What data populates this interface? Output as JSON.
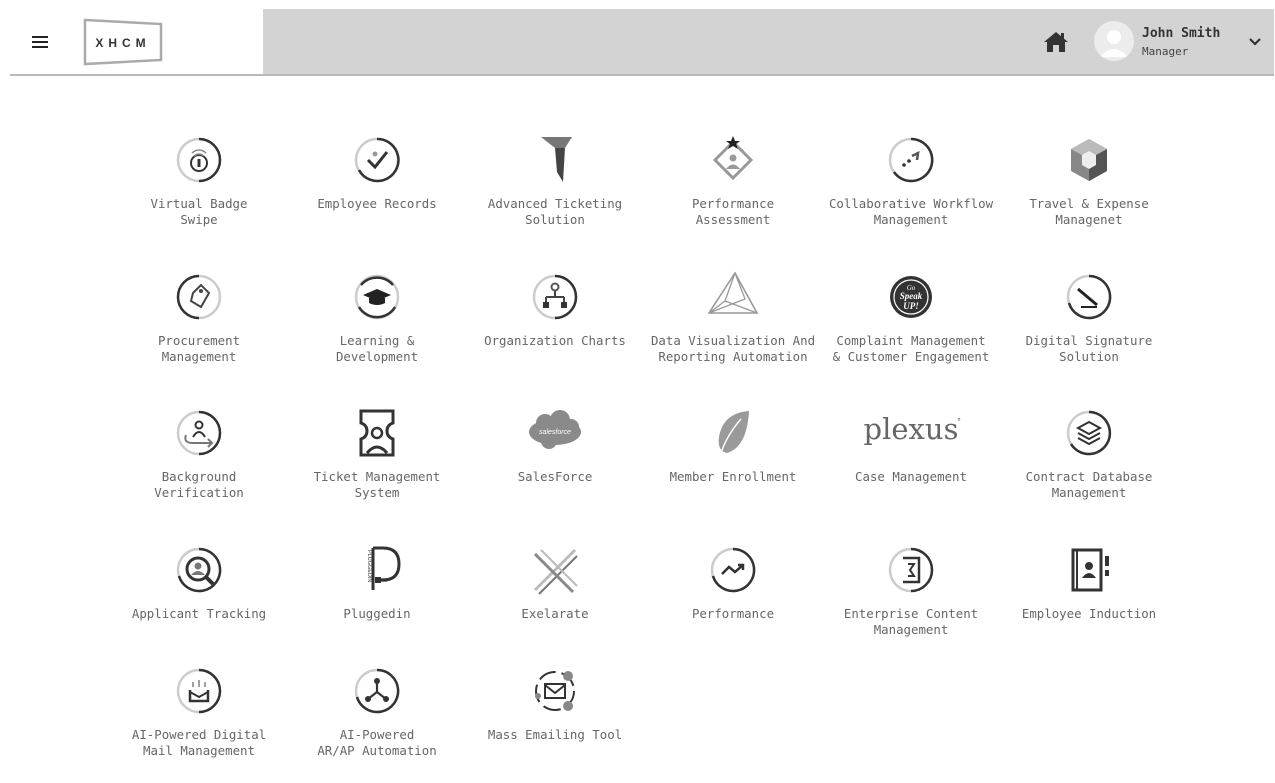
{
  "header": {
    "logo_text": "XHCM",
    "user": {
      "name": "John Smith",
      "role": "Manager"
    }
  },
  "apps": [
    {
      "label": "Virtual Badge\nSwipe",
      "icon": "badge-swipe-icon"
    },
    {
      "label": "Employee Records",
      "icon": "checkmark-dial-icon"
    },
    {
      "label": "Advanced Ticketing\nSolution",
      "icon": "ticketing-logo-icon"
    },
    {
      "label": "Performance\nAssessment",
      "icon": "star-diamond-icon"
    },
    {
      "label": "Collaborative Workflow\nManagement",
      "icon": "workflow-dial-icon"
    },
    {
      "label": "Travel & Expense\nManagenet",
      "icon": "hexagon-logo-icon"
    },
    {
      "label": "Procurement\nManagement",
      "icon": "tag-icon"
    },
    {
      "label": "Learning &\nDevelopment",
      "icon": "graduation-cap-icon"
    },
    {
      "label": "Organization Charts",
      "icon": "org-chart-icon"
    },
    {
      "label": "Data Visualization And\nReporting Automation",
      "icon": "pyramid-chart-icon"
    },
    {
      "label": "Complaint Management\n& Customer Engagement",
      "icon": "go-speak-up-badge-icon"
    },
    {
      "label": "Digital Signature\nSolution",
      "icon": "signature-pen-icon"
    },
    {
      "label": "Background\nVerification",
      "icon": "person-verify-icon"
    },
    {
      "label": "Ticket Management\nSystem",
      "icon": "ticket-person-icon"
    },
    {
      "label": "SalesForce",
      "icon": "salesforce-cloud-icon"
    },
    {
      "label": "Member Enrollment",
      "icon": "leaf-icon"
    },
    {
      "label": "Case Management",
      "icon": "plexus-wordmark-icon"
    },
    {
      "label": "Contract Database\nManagement",
      "icon": "layers-icon"
    },
    {
      "label": "Applicant Tracking",
      "icon": "magnifier-person-icon"
    },
    {
      "label": "Pluggedin",
      "icon": "pluggedin-logo-icon"
    },
    {
      "label": "Exelarate",
      "icon": "cross-arrows-icon"
    },
    {
      "label": "Performance",
      "icon": "trend-dial-icon"
    },
    {
      "label": "Enterprise Content\nManagement",
      "icon": "document-dial-icon"
    },
    {
      "label": "Employee Induction",
      "icon": "id-book-icon"
    },
    {
      "label": "AI-Powered Digital\nMail Management",
      "icon": "mail-tray-icon"
    },
    {
      "label": "AI-Powered\nAR/AP Automation",
      "icon": "nodes-dial-icon"
    },
    {
      "label": "Mass Emailing Tool",
      "icon": "orbit-mail-icon"
    }
  ],
  "icon_labels": {
    "salesforce": "salesforce",
    "plexus": "plexus",
    "go_speak_up": [
      "Go",
      "Speak",
      "UP!"
    ],
    "pluggedin": "PLUGGEDIN"
  }
}
